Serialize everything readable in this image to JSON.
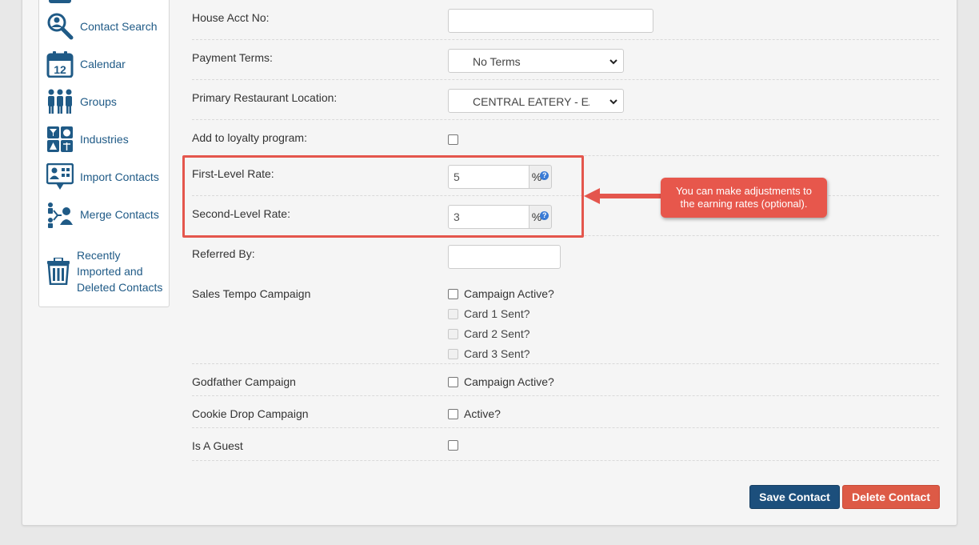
{
  "sidebar": {
    "items": [
      {
        "label": "Contact Search",
        "icon": "magnifier-person-icon"
      },
      {
        "label": "Calendar",
        "icon": "calendar-icon",
        "icon_text": "12"
      },
      {
        "label": "Groups",
        "icon": "people-group-icon"
      },
      {
        "label": "Industries",
        "icon": "industries-grid-icon"
      },
      {
        "label": "Import Contacts",
        "icon": "import-contacts-icon"
      },
      {
        "label": "Merge Contacts",
        "icon": "merge-contacts-icon"
      },
      {
        "label_lines": [
          "Recently",
          "Imported and",
          "Deleted Contacts"
        ],
        "icon": "trash-icon"
      }
    ]
  },
  "form": {
    "house_acct": {
      "label": "House Acct No:",
      "value": ""
    },
    "payment_terms": {
      "label": "Payment Terms:",
      "value": "No Terms"
    },
    "primary_location": {
      "label": "Primary Restaurant Location:",
      "value": "CENTRAL EATERY - EAST"
    },
    "loyalty": {
      "label": "Add to loyalty program:",
      "checked": false
    },
    "first_rate": {
      "label": "First-Level Rate:",
      "value": "5",
      "unit": "%",
      "help": "?"
    },
    "second_rate": {
      "label": "Second-Level Rate:",
      "value": "3",
      "unit": "%",
      "help": "?"
    },
    "referred_by": {
      "label": "Referred By:",
      "value": ""
    },
    "sales_tempo": {
      "label": "Sales Tempo Campaign",
      "options": [
        {
          "label": "Campaign Active?",
          "checked": false,
          "disabled": false
        },
        {
          "label": "Card 1 Sent?",
          "checked": false,
          "disabled": true
        },
        {
          "label": "Card 2 Sent?",
          "checked": false,
          "disabled": true
        },
        {
          "label": "Card 3 Sent?",
          "checked": false,
          "disabled": true
        }
      ]
    },
    "godfather": {
      "label": "Godfather Campaign",
      "option": "Campaign Active?"
    },
    "cookie_drop": {
      "label": "Cookie Drop Campaign",
      "option": "Active?"
    },
    "is_guest": {
      "label": "Is A Guest",
      "checked": false
    }
  },
  "callout": {
    "line1": "You can make adjustments to",
    "line2": "the earning rates (optional).",
    "color": "#e7574c"
  },
  "buttons": {
    "save": "Save Contact",
    "delete": "Delete Contact"
  },
  "colors": {
    "primary": "#1c4f7c",
    "danger": "#dd5a46",
    "link": "#1f5a86",
    "highlight": "#e4564d"
  }
}
